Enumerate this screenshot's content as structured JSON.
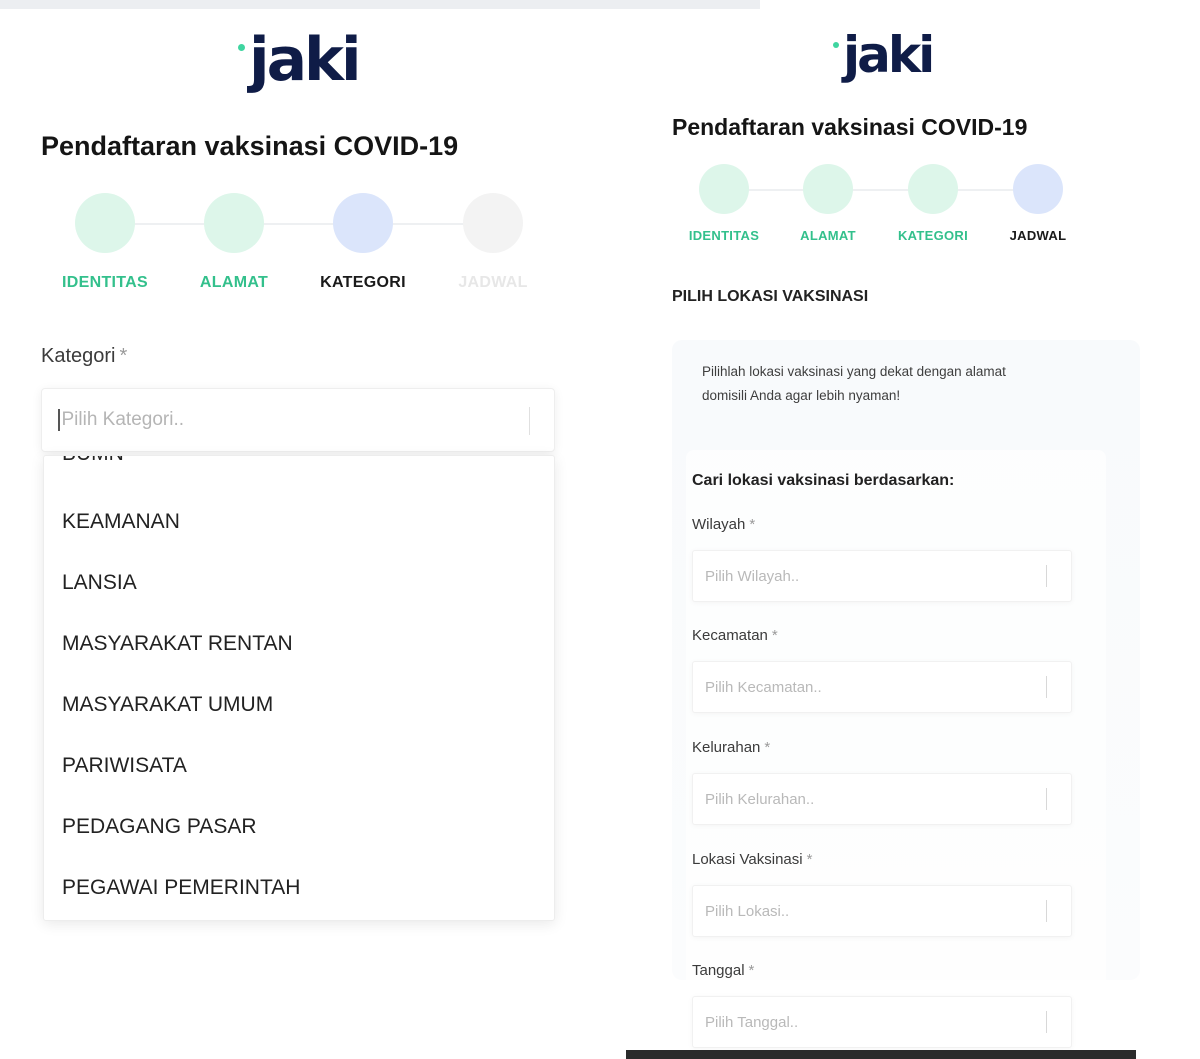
{
  "left": {
    "logo": "jaki",
    "title": "Pendaftaran vaksinasi COVID-19",
    "steps": [
      {
        "label": "IDENTITAS",
        "state": "done"
      },
      {
        "label": "ALAMAT",
        "state": "done"
      },
      {
        "label": "KATEGORI",
        "state": "active"
      },
      {
        "label": "JADWAL",
        "state": "todo"
      }
    ],
    "kategori": {
      "label": "Kategori",
      "required": "*",
      "placeholder": "Pilih Kategori..",
      "partial_item": "BUMN",
      "options": [
        "KEAMANAN",
        "LANSIA",
        "MASYARAKAT RENTAN",
        "MASYARAKAT UMUM",
        "PARIWISATA",
        "PEDAGANG PASAR",
        "PEGAWAI PEMERINTAH"
      ]
    }
  },
  "right": {
    "logo": "jaki",
    "title": "Pendaftaran vaksinasi COVID-19",
    "steps": [
      {
        "label": "IDENTITAS",
        "state": "done"
      },
      {
        "label": "ALAMAT",
        "state": "done"
      },
      {
        "label": "KATEGORI",
        "state": "done"
      },
      {
        "label": "JADWAL",
        "state": "active"
      }
    ],
    "section_title": "PILIH LOKASI VAKSINASI",
    "note": "Pilihlah lokasi vaksinasi yang dekat dengan alamat domisili Anda agar lebih nyaman!",
    "search_heading": "Cari lokasi vaksinasi berdasarkan:",
    "fields": [
      {
        "label": "Wilayah",
        "required": "*",
        "placeholder": "Pilih Wilayah.."
      },
      {
        "label": "Kecamatan",
        "required": "*",
        "placeholder": "Pilih Kecamatan.."
      },
      {
        "label": "Kelurahan",
        "required": "*",
        "placeholder": "Pilih Kelurahan.."
      },
      {
        "label": "Lokasi Vaksinasi",
        "required": "*",
        "placeholder": "Pilih Lokasi.."
      },
      {
        "label": "Tanggal",
        "required": "*",
        "placeholder": "Pilih Tanggal.."
      }
    ]
  },
  "colors": {
    "brand_navy": "#0f1c47",
    "brand_green_dot": "#3fd5a0",
    "step_done_text": "#33c08c",
    "step_done_circle": "#ddf6ea",
    "step_active_circle": "#dbe5fb",
    "step_todo_circle": "#f3f3f3"
  }
}
